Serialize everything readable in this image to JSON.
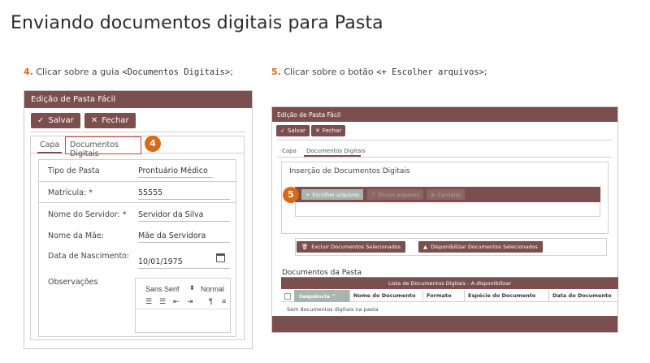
{
  "page": {
    "title": "Enviando documentos digitais para Pasta"
  },
  "colors": {
    "brand": "#7a4f4d",
    "step_accent": "#d96a1a",
    "highlight_border": "#e23b3b",
    "primary_button": "#a8b6ae"
  },
  "steps": [
    {
      "number": "4.",
      "text": " Clicar sobre a guia ",
      "code": "<Documentos Digitais>",
      "suffix": ";"
    },
    {
      "number": "5.",
      "text": " Clicar sobre o botão ",
      "code": "<+ Escolher arquivos>",
      "suffix": ";"
    }
  ],
  "left_panel": {
    "header": "Edição de Pasta Fácil",
    "save_label": "Salvar",
    "close_label": "Fechar",
    "tabs": {
      "capa": "Capa",
      "docs": "Documentos Digitais"
    },
    "badge": "4",
    "fields": {
      "tipo_label": "Tipo de Pasta",
      "tipo_value": "Prontuário Médico",
      "matricula_label": "Matrícula: *",
      "matricula_value": "55555",
      "servidor_label": "Nome do Servidor: *",
      "servidor_value": "Servidor da Silva",
      "mae_label": "Nome da Mãe:",
      "mae_value": "Mãe da Servidora",
      "nasc_label": "Data de Nascimento:",
      "nasc_value": "10/01/1975",
      "obs_label": "Observações"
    },
    "editor": {
      "font": "Sans Serif",
      "caret": "⬍",
      "size": "Normal"
    }
  },
  "right_panel": {
    "header": "Edição de Pasta Fácil",
    "save_label": "Salvar",
    "close_label": "Fechar",
    "tabs": {
      "capa": "Capa",
      "docs": "Documentos Digitais"
    },
    "badge": "5",
    "insert_title": "Inserção de Documentos Digitais",
    "upload": {
      "choose": "Escolher arquivos",
      "send": "Enviar arquivos",
      "cancel": "Cancelar"
    },
    "actions": {
      "delete": "Excluir Documentos Selecionados",
      "publish": "Disponibilizar Documentos Selecionados"
    },
    "section_title": "Documentos da Pasta",
    "list_bar": "Lista de Documentos Digitais - A disponibilizar",
    "columns": {
      "seq": "Sequência",
      "name": "Nome do Documento",
      "format": "Formato",
      "species": "Espécie do Documento",
      "date": "Data do Documento"
    },
    "empty": "Sem documentos digitais na pasta"
  }
}
